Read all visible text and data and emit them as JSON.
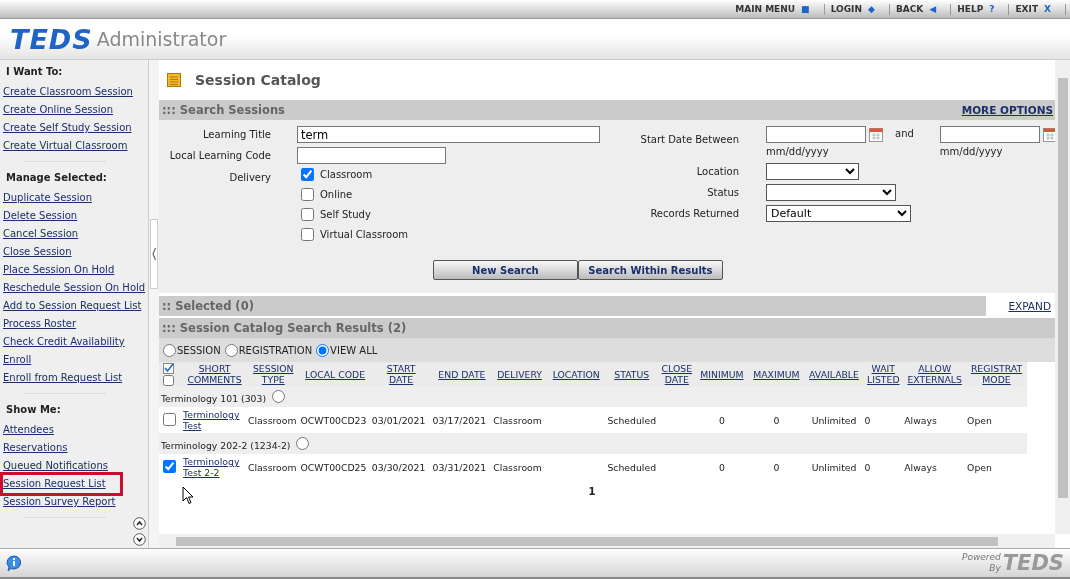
{
  "top_nav": [
    {
      "label": "MAIN MENU",
      "icon": "■"
    },
    {
      "label": "LOGIN",
      "icon": "◆"
    },
    {
      "label": "BACK",
      "icon": "◀"
    },
    {
      "label": "HELP",
      "icon": "?"
    },
    {
      "label": "EXIT",
      "icon": "X"
    }
  ],
  "header": {
    "logo": "TEDS",
    "product": "Administrator"
  },
  "sidebar": {
    "sections": [
      {
        "title": "I Want To:",
        "items": [
          {
            "label": "Create Classroom Session",
            "highlighted": false
          },
          {
            "label": "Create Online Session",
            "highlighted": false
          },
          {
            "label": "Create Self Study Session",
            "highlighted": false
          },
          {
            "label": "Create Virtual Classroom",
            "highlighted": false
          }
        ]
      },
      {
        "title": "Manage Selected:",
        "items": [
          {
            "label": "Duplicate Session",
            "highlighted": false
          },
          {
            "label": "Delete Session",
            "highlighted": false
          },
          {
            "label": "Cancel Session",
            "highlighted": false
          },
          {
            "label": "Close Session",
            "highlighted": false
          },
          {
            "label": "Place Session On Hold",
            "highlighted": false
          },
          {
            "label": "Reschedule Session On Hold",
            "highlighted": false
          },
          {
            "label": "Add to Session Request List",
            "highlighted": false
          },
          {
            "label": "Process Roster",
            "highlighted": false
          },
          {
            "label": "Check Credit Availability",
            "highlighted": false
          },
          {
            "label": "Enroll",
            "highlighted": false
          },
          {
            "label": "Enroll from Request List",
            "highlighted": false
          }
        ]
      },
      {
        "title": "Show Me:",
        "items": [
          {
            "label": "Attendees",
            "highlighted": false
          },
          {
            "label": "Reservations",
            "highlighted": false
          },
          {
            "label": "Queued Notifications",
            "highlighted": false
          },
          {
            "label": "Session Request List",
            "highlighted": true
          },
          {
            "label": "Session Survey Report",
            "highlighted": false
          }
        ]
      }
    ]
  },
  "page_title": "Session Catalog",
  "search": {
    "title": "::: Search Sessions",
    "more_options": "MORE OPTIONS",
    "learning_title": {
      "label": "Learning Title",
      "value": "term"
    },
    "local_code": {
      "label": "Local Learning Code"
    },
    "delivery": {
      "label": "Delivery",
      "options": [
        {
          "label": "Classroom",
          "checked": true
        },
        {
          "label": "Online",
          "checked": false
        },
        {
          "label": "Self Study",
          "checked": false
        },
        {
          "label": "Virtual Classroom",
          "checked": false
        }
      ]
    },
    "start_date": {
      "label": "Start Date Between",
      "and": "and",
      "from_hint": "mm/dd/yyyy",
      "to_hint": "mm/dd/yyyy"
    },
    "location": {
      "label": "Location"
    },
    "status": {
      "label": "Status"
    },
    "records_returned": {
      "label": "Records Returned",
      "value": "Default"
    },
    "buttons": [
      "New Search",
      "Search Within Results"
    ]
  },
  "selected_bar": {
    "title": ":: Selected (0)",
    "expand": "EXPAND"
  },
  "results": {
    "title": "::: Session Catalog Search Results (2)",
    "views": [
      {
        "label": "SESSION",
        "selected": false
      },
      {
        "label": "REGISTRATION",
        "selected": false
      },
      {
        "label": "VIEW ALL",
        "selected": true
      }
    ],
    "select_all": {
      "checked": false
    },
    "columns": [
      [
        "SHORT",
        "COMMENTS"
      ],
      [
        "SESSION",
        "TYPE"
      ],
      [
        "LOCAL CODE"
      ],
      [
        "START",
        "DATE"
      ],
      [
        "END DATE"
      ],
      [
        "DELIVERY"
      ],
      [
        "LOCATION"
      ],
      [
        "STATUS"
      ],
      [
        "CLOSE",
        "DATE"
      ],
      [
        "MINIMUM"
      ],
      [
        "MAXIMUM"
      ],
      [
        "AVAILABLE"
      ],
      [
        "WAIT",
        "LISTED"
      ],
      [
        "ALLOW",
        "EXTERNALS"
      ],
      [
        "REGISTRAT",
        "MODE"
      ]
    ],
    "groups": [
      {
        "title": "Terminology 101 (303)",
        "selected": false,
        "rows": [
          {
            "checked": false,
            "cells": [
              "Terminology Test",
              "Classroom",
              "OCWT00CD23",
              "03/01/2021",
              "03/17/2021",
              "Classroom",
              "",
              "Scheduled",
              "",
              "0",
              "0",
              "Unlimited",
              "0",
              "Always",
              "Open"
            ]
          }
        ]
      },
      {
        "title": "Terminology 202-2 (1234-2)",
        "selected": false,
        "rows": [
          {
            "checked": true,
            "cells": [
              "Terminology Test 2-2",
              "Classroom",
              "OCWT00CD25",
              "03/30/2021",
              "03/31/2021",
              "Classroom",
              "",
              "Scheduled",
              "",
              "0",
              "0",
              "Unlimited",
              "0",
              "Always",
              "Open"
            ]
          }
        ]
      }
    ],
    "pages": "1"
  },
  "footer": {
    "powered": "Powered",
    "by": "By",
    "logo": "TEDS"
  }
}
